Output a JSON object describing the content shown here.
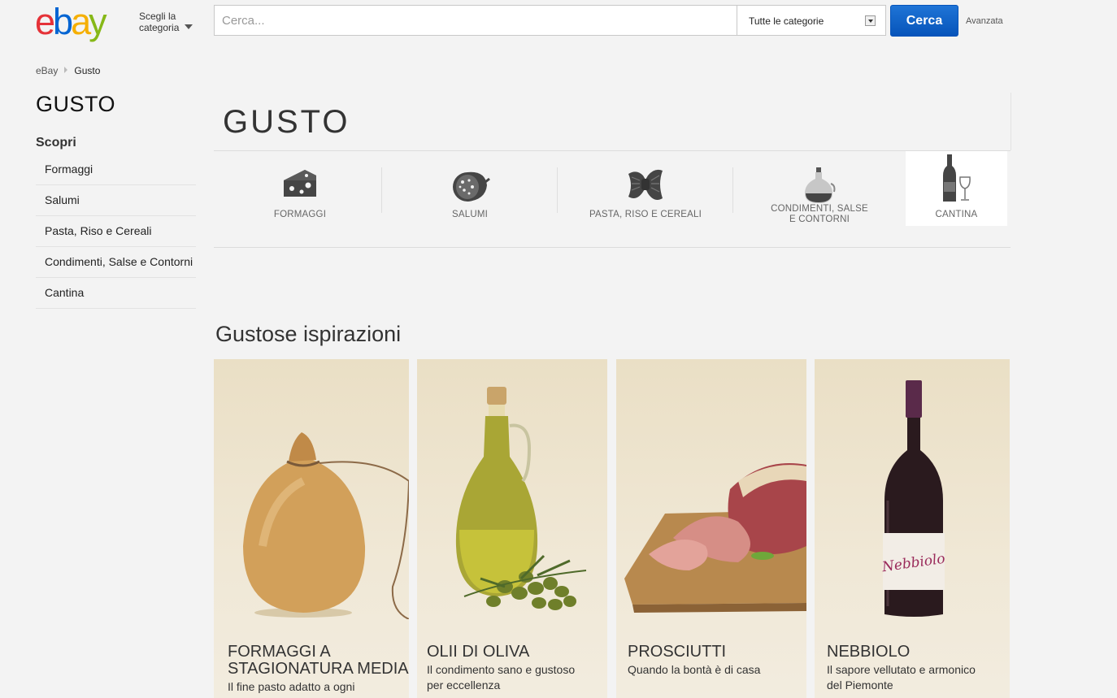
{
  "header": {
    "logo_letters": [
      "e",
      "b",
      "a",
      "y"
    ],
    "category_picker": [
      "Scegli la",
      "categoria"
    ],
    "search_placeholder": "Cerca...",
    "category_select": "Tutte le categorie",
    "search_button": "Cerca",
    "advanced_link": "Avanzata"
  },
  "breadcrumb": [
    "eBay",
    "Gusto"
  ],
  "sidebar": {
    "title": "GUSTO",
    "subtitle": "Scopri",
    "items": [
      {
        "label": "Formaggi"
      },
      {
        "label": "Salumi"
      },
      {
        "label": "Pasta, Riso e Cereali"
      },
      {
        "label": "Condimenti, Salse e Contorni"
      },
      {
        "label": "Cantina"
      }
    ]
  },
  "main": {
    "title": "GUSTO",
    "categories": [
      {
        "label": "FORMAGGI",
        "icon": "cheese-icon"
      },
      {
        "label": "SALUMI",
        "icon": "salami-icon"
      },
      {
        "label": "PASTA, RISO E CEREALI",
        "icon": "pasta-icon"
      },
      {
        "label_lines": [
          "CONDIMENTI, SALSE",
          "E CONTORNI"
        ],
        "icon": "oil-cruet-icon"
      },
      {
        "label": "CANTINA",
        "icon": "wine-bottle-glass-icon",
        "active": true
      }
    ],
    "section_title": "Gustose ispirazioni",
    "cards": [
      {
        "title_lines": [
          "FORMAGGI A",
          "STAGIONATURA MEDIA"
        ],
        "desc_lines": [
          "Il fine pasto adatto a ogni"
        ]
      },
      {
        "title_lines": [
          "OLII DI OLIVA"
        ],
        "desc_lines": [
          "Il condimento sano e gustoso",
          "per eccellenza"
        ]
      },
      {
        "title_lines": [
          "PROSCIUTTI"
        ],
        "desc_lines": [
          "Quando la bontà è di casa"
        ]
      },
      {
        "title_lines": [
          "NEBBIOLO"
        ],
        "desc_lines": [
          "Il sapore vellutato e armonico",
          "del Piemonte"
        ],
        "label_text": "Nebbiolo"
      }
    ]
  },
  "colors": {
    "ebay_red": "#e53238",
    "ebay_blue": "#0064d2",
    "ebay_yellow": "#f5af02",
    "ebay_green": "#86b817",
    "button_blue": "#0654ba",
    "card_bg": "#eadfc5"
  }
}
